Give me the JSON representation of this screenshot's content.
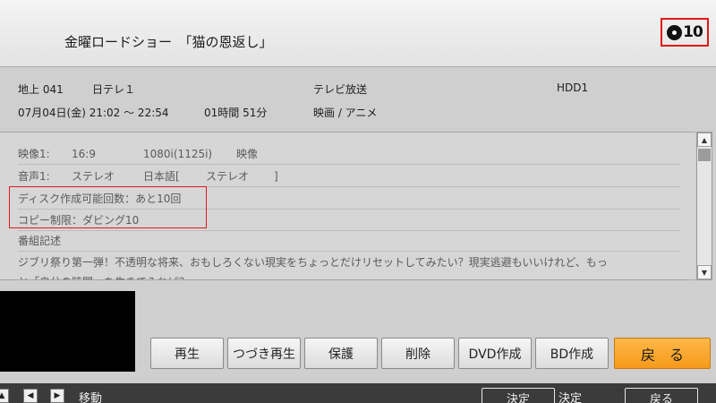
{
  "header": {
    "title": "金曜ロードショー　「猫の恩返し」",
    "dubbing_badge": {
      "icon": "disc-icon",
      "count": "10",
      "highlight_color": "#e01818"
    }
  },
  "info": {
    "channel": "地上 041",
    "station": "日テレ１",
    "broadcast_type": "テレビ放送",
    "storage": "HDD1",
    "datetime": "07月04日(金) 21:02 ～ 22:54",
    "duration": "01時間 51分",
    "genre": "映画 / アニメ"
  },
  "details": {
    "video_label": "映像1:",
    "video_aspect": "16:9",
    "video_resolution": "1080i(1125i)",
    "video_type": "映像",
    "audio_label": "音声1:",
    "audio_mode": "ステレオ",
    "audio_lang": "日本語[",
    "audio_lang_mode": "ステレオ",
    "audio_close": "]",
    "disc_remaining": "ディスク作成可能回数：あと10回",
    "copy_limit": "コピー制限：ダビング10",
    "description_heading": "番組記述",
    "description": "ジブリ祭り第一弾！不透明な将来、おもしろくない現実をちょっとだけリセットしてみたい？現実逃避もいいけれど、もっ",
    "description_cut": "と「自分の時間」を生きてみれば？"
  },
  "buttons": {
    "play": "再生",
    "resume": "つづき再生",
    "protect": "保護",
    "delete": "削除",
    "dvd": "DVD作成",
    "bd": "BD作成",
    "back": "戻　る",
    "back_color": "#f7a52a"
  },
  "footer": {
    "move_label": "移動",
    "enter_key": "決定",
    "enter_label": "決定",
    "back_key": "戻る"
  }
}
